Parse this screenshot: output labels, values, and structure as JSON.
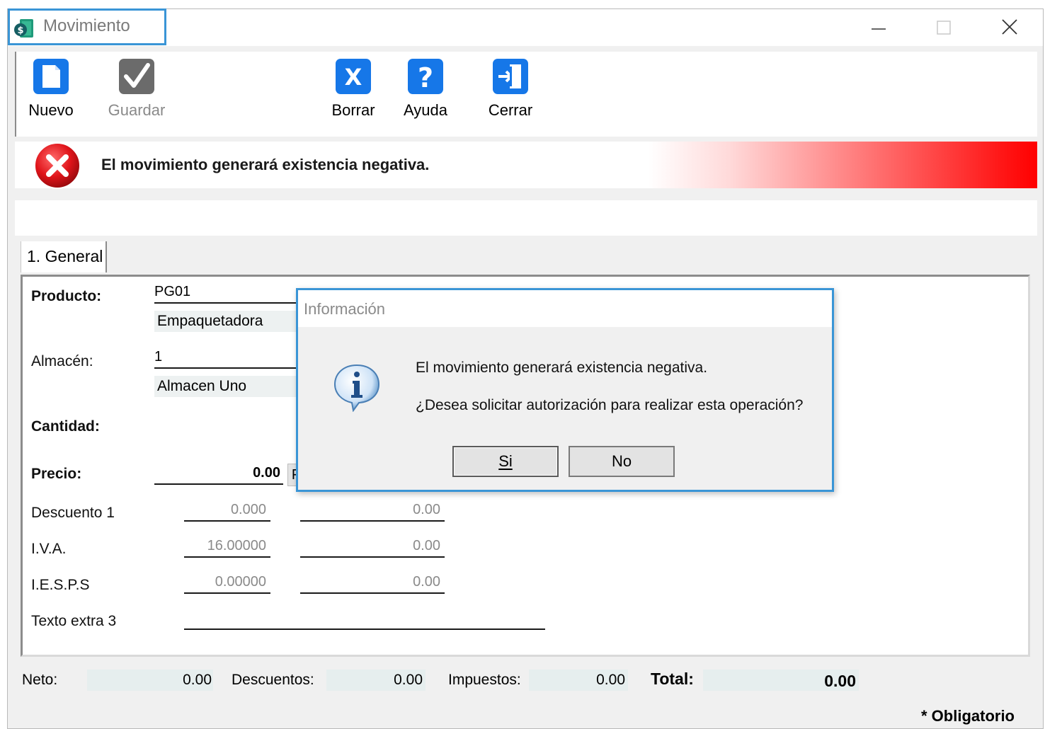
{
  "window": {
    "title": "Movimiento"
  },
  "toolbar": {
    "nuevo": "Nuevo",
    "guardar": "Guardar",
    "borrar": "Borrar",
    "ayuda": "Ayuda",
    "cerrar": "Cerrar"
  },
  "banner": {
    "message": "El movimiento generará existencia negativa."
  },
  "tabs": {
    "general": "1. General"
  },
  "form": {
    "producto_label": "Producto:",
    "producto_code": "PG01",
    "producto_name": "Empaquetadora",
    "almacen_label": "Almacén:",
    "almacen_code": "1",
    "almacen_name": "Almacen Uno",
    "cantidad_label": "Cantidad:",
    "precio_label": "Precio:",
    "precio_value": "0.00",
    "precio_suffix": "F",
    "descuento1_label": "Descuento 1",
    "descuento1_pct": "0.000",
    "descuento1_amount": "0.00",
    "iva_label": "I.V.A.",
    "iva_pct": "16.00000",
    "iva_amount": "0.00",
    "ieps_label": "I.E.S.P.S",
    "ieps_pct": "0.00000",
    "ieps_amount": "0.00",
    "texto_extra3_label": "Texto extra 3",
    "texto_extra3_value": ""
  },
  "footer": {
    "neto_label": "Neto:",
    "neto_value": "0.00",
    "descuentos_label": "Descuentos:",
    "descuentos_value": "0.00",
    "impuestos_label": "Impuestos:",
    "impuestos_value": "0.00",
    "total_label": "Total:",
    "total_value": "0.00",
    "obligatorio": "* Obligatorio"
  },
  "dialog": {
    "title": "Información",
    "line1": "El movimiento generará existencia negativa.",
    "line2": "¿Desea solicitar autorización para realizar esta operación?",
    "yes": "Si",
    "no": "No"
  },
  "colors": {
    "accent_border": "#3a95d6",
    "toolbar_icon_blue": "#1677e8",
    "error_red": "#e0141a",
    "readonly_fill": "#edf1f1"
  },
  "icons": [
    "app-icon",
    "minimize-icon",
    "maximize-icon",
    "close-icon",
    "new-document-icon",
    "save-check-icon",
    "delete-x-icon",
    "help-question-icon",
    "exit-door-icon",
    "error-circle-icon",
    "info-balloon-icon"
  ]
}
